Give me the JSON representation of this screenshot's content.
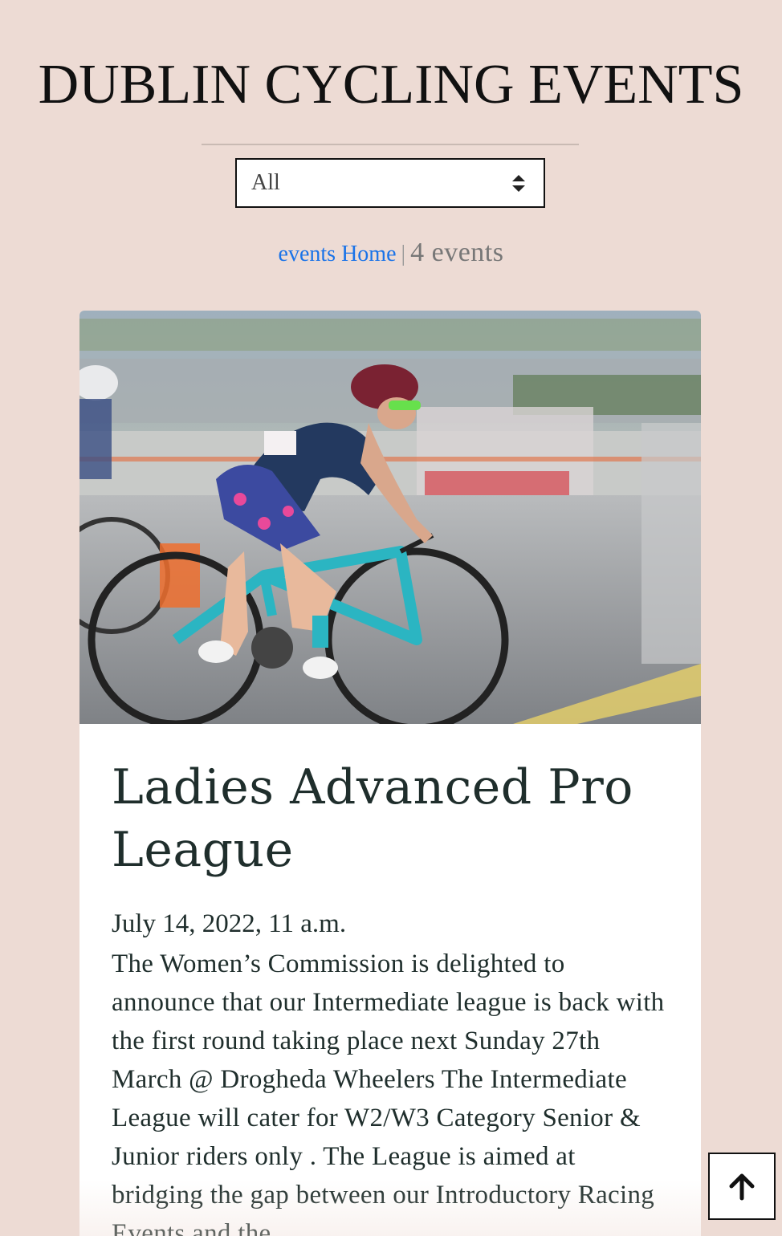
{
  "header": {
    "title": "DUBLIN CYCLING EVENTS"
  },
  "filter": {
    "selected": "All"
  },
  "events_bar": {
    "home_link": "events Home",
    "separator": "|",
    "count": "4 events"
  },
  "event": {
    "title": "Ladies Advanced Pro League",
    "date": "July 14, 2022, 11 a.m.",
    "description": "The Women’s Commission is delighted to announce that our Intermediate league is back with the first round taking place next Sunday 27th March @ Drogheda Wheelers The Intermediate League will cater for W2/W3 Category Senior & Junior riders only . The League is aimed at bridging the gap between our Introductory Racing Events and the",
    "image_icon": "cyclist-photo"
  },
  "back_to_top": {
    "icon": "arrow-up-icon"
  },
  "colors": {
    "background": "#eddbd4",
    "link": "#1a73e8",
    "title_text": "#1f2e2c"
  }
}
